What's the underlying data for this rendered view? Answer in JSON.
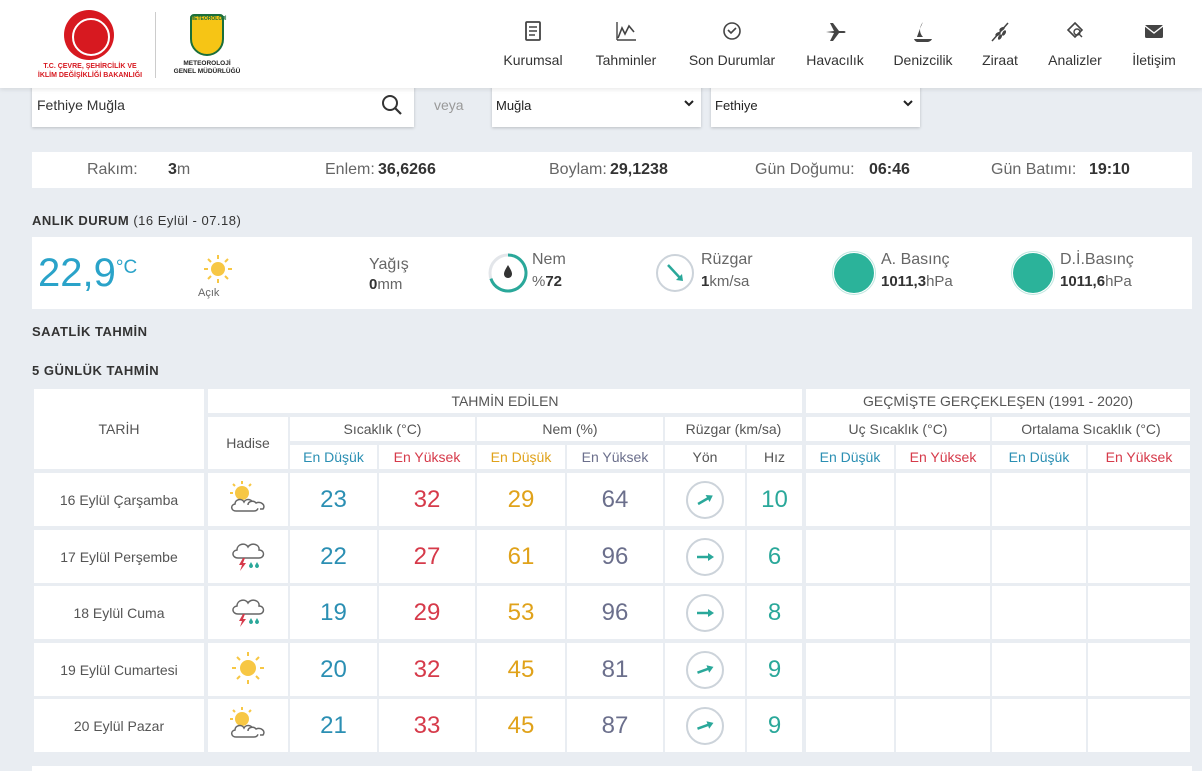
{
  "header": {
    "ministry_lines": [
      "T.C. ÇEVRE, ŞEHİRCİLİK VE",
      "İKLİM DEĞİŞİKLİĞİ BAKANLIĞI"
    ],
    "mgm_cap": "METEOROLOJİ",
    "mgm_lines": [
      "METEOROLOJİ",
      "GENEL MÜDÜRLÜĞÜ"
    ],
    "nav": [
      {
        "label": "Kurumsal",
        "icon": "document-icon"
      },
      {
        "label": "Tahminler",
        "icon": "chart-icon"
      },
      {
        "label": "Son Durumlar",
        "icon": "check-circle-icon"
      },
      {
        "label": "Havacılık",
        "icon": "plane-icon"
      },
      {
        "label": "Denizcilik",
        "icon": "sailboat-icon"
      },
      {
        "label": "Ziraat",
        "icon": "wheat-icon"
      },
      {
        "label": "Analizler",
        "icon": "analysis-icon"
      },
      {
        "label": "İletişim",
        "icon": "mail-icon"
      }
    ]
  },
  "search": {
    "value": "Fethiye Muğla",
    "veya": "veya",
    "province": "Muğla",
    "district": "Fethiye"
  },
  "info": {
    "rakim_label": "Rakım:",
    "rakim_value": "3",
    "rakim_unit": "m",
    "enlem_label": "Enlem:",
    "enlem_value": "36,6266",
    "boylam_label": "Boylam:",
    "boylam_value": "29,1238",
    "gundogumu_label": "Gün Doğumu:",
    "gundogumu_value": "06:46",
    "gunbatimi_label": "Gün Batımı:",
    "gunbatimi_value": "19:10"
  },
  "current": {
    "title": "ANLIK DURUM",
    "subtitle": "(16 Eylül - 07.18)",
    "temp": "22,9",
    "temp_unit": "°C",
    "condition": "Açık",
    "yagis_label": "Yağış",
    "yagis_value": "0",
    "yagis_unit": "mm",
    "nem_label": "Nem",
    "nem_prefix": "%",
    "nem_value": "72",
    "ruzgar_label": "Rüzgar",
    "ruzgar_value": "1",
    "ruzgar_unit": "km/sa",
    "abasinc_label": "A. Basınç",
    "abasinc_value": "1011,3",
    "abasinc_unit": "hPa",
    "dibasinc_label": "D.İ.Basınç",
    "dibasinc_value": "1011,6",
    "dibasinc_unit": "hPa",
    "colors": {
      "temp": "#2aa3c9",
      "pressure": "#2bb39a"
    }
  },
  "hourly_title": "SAATLİK TAHMİN",
  "forecast_title": "5 GÜNLÜK TAHMİN",
  "table": {
    "tarih": "TARİH",
    "tahmin_edilen": "TAHMİN EDİLEN",
    "gecmiste": "GEÇMİŞTE GERÇEKLEŞEN (1991 - 2020)",
    "hadise": "Hadise",
    "sicaklik": "Sıcaklık (°C)",
    "nem": "Nem (%)",
    "ruzgar": "Rüzgar (km/sa)",
    "uc_sicaklik": "Uç Sıcaklık (°C)",
    "ort_sicaklik": "Ortalama Sıcaklık (°C)",
    "en_dusuk": "En Düşük",
    "en_yuksek": "En Yüksek",
    "yon": "Yön",
    "hiz": "Hız",
    "rows": [
      {
        "date": "16 Eylül Çarşamba",
        "icon": "partly-cloudy-icon",
        "tmin": "23",
        "tmax": "32",
        "hmin": "29",
        "hmax": "64",
        "wind_dir_deg": 60,
        "wind_speed": "10"
      },
      {
        "date": "17 Eylül Perşembe",
        "icon": "thunderstorm-icon",
        "tmin": "22",
        "tmax": "27",
        "hmin": "61",
        "hmax": "96",
        "wind_dir_deg": 90,
        "wind_speed": "6"
      },
      {
        "date": "18 Eylül Cuma",
        "icon": "thunderstorm-icon",
        "tmin": "19",
        "tmax": "29",
        "hmin": "53",
        "hmax": "96",
        "wind_dir_deg": 90,
        "wind_speed": "8"
      },
      {
        "date": "19 Eylül Cumartesi",
        "icon": "sunny-icon",
        "tmin": "20",
        "tmax": "32",
        "hmin": "45",
        "hmax": "81",
        "wind_dir_deg": 70,
        "wind_speed": "9"
      },
      {
        "date": "20 Eylül Pazar",
        "icon": "partly-cloudy-icon",
        "tmin": "21",
        "tmax": "33",
        "hmin": "45",
        "hmax": "87",
        "wind_dir_deg": 70,
        "wind_speed": "9"
      }
    ]
  }
}
